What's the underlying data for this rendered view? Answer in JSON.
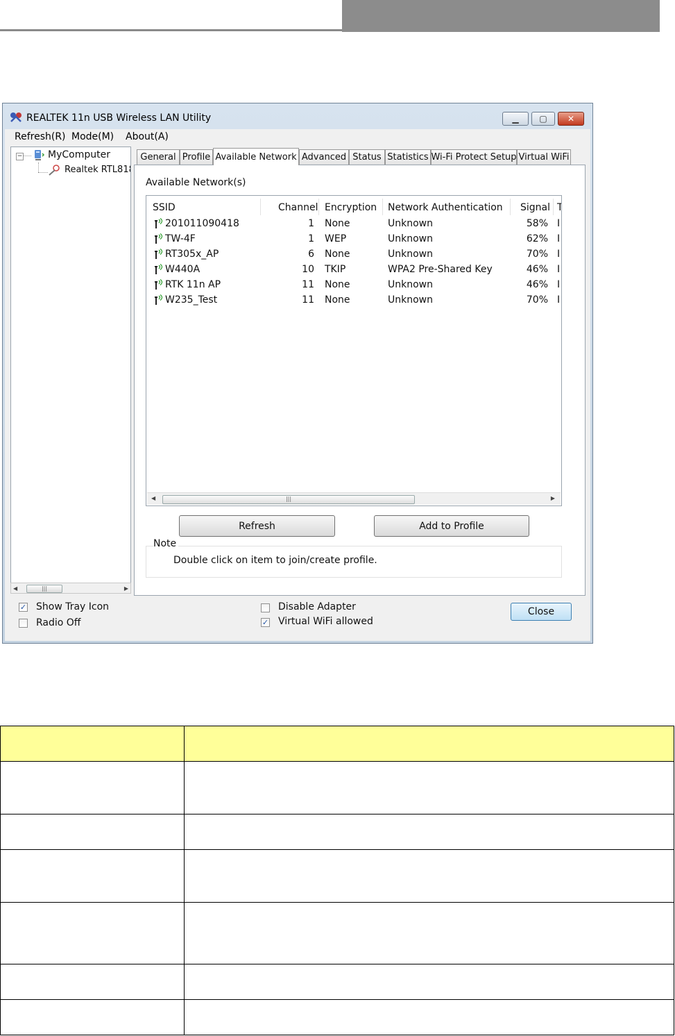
{
  "window": {
    "title": "REALTEK 11n USB Wireless LAN Utility",
    "menu": [
      "Refresh(R)",
      "Mode(M)",
      "About(A)"
    ]
  },
  "tree": {
    "root": "MyComputer",
    "child": "Realtek RTL818"
  },
  "tabs": [
    "General",
    "Profile",
    "Available Network",
    "Advanced",
    "Status",
    "Statistics",
    "Wi-Fi Protect Setup",
    "Virtual WiFi"
  ],
  "active_tab": "Available Network",
  "panel": {
    "section_label": "Available Network(s)",
    "columns": [
      "SSID",
      "Channel",
      "Encryption",
      "Network Authentication",
      "Signal",
      "T"
    ],
    "rows": [
      {
        "ssid": "201011090418",
        "channel": "1",
        "encryption": "None",
        "auth": "Unknown",
        "signal": "58%",
        "type": "I"
      },
      {
        "ssid": "TW-4F",
        "channel": "1",
        "encryption": "WEP",
        "auth": "Unknown",
        "signal": "62%",
        "type": "I"
      },
      {
        "ssid": "RT305x_AP",
        "channel": "6",
        "encryption": "None",
        "auth": "Unknown",
        "signal": "70%",
        "type": "I"
      },
      {
        "ssid": "W440A",
        "channel": "10",
        "encryption": "TKIP",
        "auth": "WPA2 Pre-Shared Key",
        "signal": "46%",
        "type": "I"
      },
      {
        "ssid": "RTK 11n AP",
        "channel": "11",
        "encryption": "None",
        "auth": "Unknown",
        "signal": "46%",
        "type": "I"
      },
      {
        "ssid": "W235_Test",
        "channel": "11",
        "encryption": "None",
        "auth": "Unknown",
        "signal": "70%",
        "type": "I"
      }
    ],
    "refresh_label": "Refresh",
    "add_profile_label": "Add to Profile",
    "note_title": "Note",
    "note_text": "Double click on item to join/create profile."
  },
  "footer": {
    "show_tray_icon": {
      "label": "Show Tray Icon",
      "checked": "✓"
    },
    "radio_off": {
      "label": "Radio Off",
      "checked": ""
    },
    "disable_adapter": {
      "label": "Disable Adapter",
      "checked": ""
    },
    "virtual_wifi_allowed": {
      "label": "Virtual WiFi allowed",
      "checked": "✓"
    },
    "close_label": "Close"
  },
  "colors": {
    "table_header": "#ffff99",
    "header_bar": "#8c8c8c",
    "close_button": "#bfe0f5"
  }
}
